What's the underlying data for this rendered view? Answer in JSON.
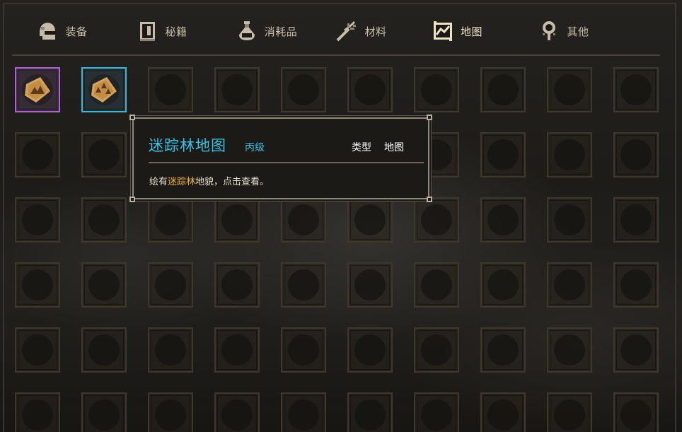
{
  "tabs": [
    {
      "label": "装备",
      "icon": "helmet-icon",
      "active": false
    },
    {
      "label": "秘籍",
      "icon": "book-icon",
      "active": false
    },
    {
      "label": "消耗品",
      "icon": "potion-icon",
      "active": false
    },
    {
      "label": "材料",
      "icon": "herb-icon",
      "active": false
    },
    {
      "label": "地图",
      "icon": "map-icon",
      "active": true
    },
    {
      "label": "其他",
      "icon": "misc-icon",
      "active": false
    }
  ],
  "inventory": {
    "columns": 10,
    "visible_rows": 6,
    "items": [
      {
        "slot": 0,
        "name": "map-item-mountain-icon",
        "rarity_color": "#b163d6"
      },
      {
        "slot": 1,
        "name": "map-item-forest-icon",
        "rarity_color": "#39b8d8"
      }
    ]
  },
  "tooltip": {
    "title": "迷踪林地图",
    "grade": "丙级",
    "type_label": "类型",
    "type_value": "地图",
    "description_prefix": "绘有",
    "description_highlight": "迷踪林",
    "description_suffix": "地貌，点击查看。",
    "title_color": "#37c2e8",
    "highlight_color": "#f2b23c"
  },
  "colors": {
    "tab_text": "#c9bfa9",
    "active_tab_underline": "#f3e8cf",
    "slot_border": "#3e372c"
  }
}
